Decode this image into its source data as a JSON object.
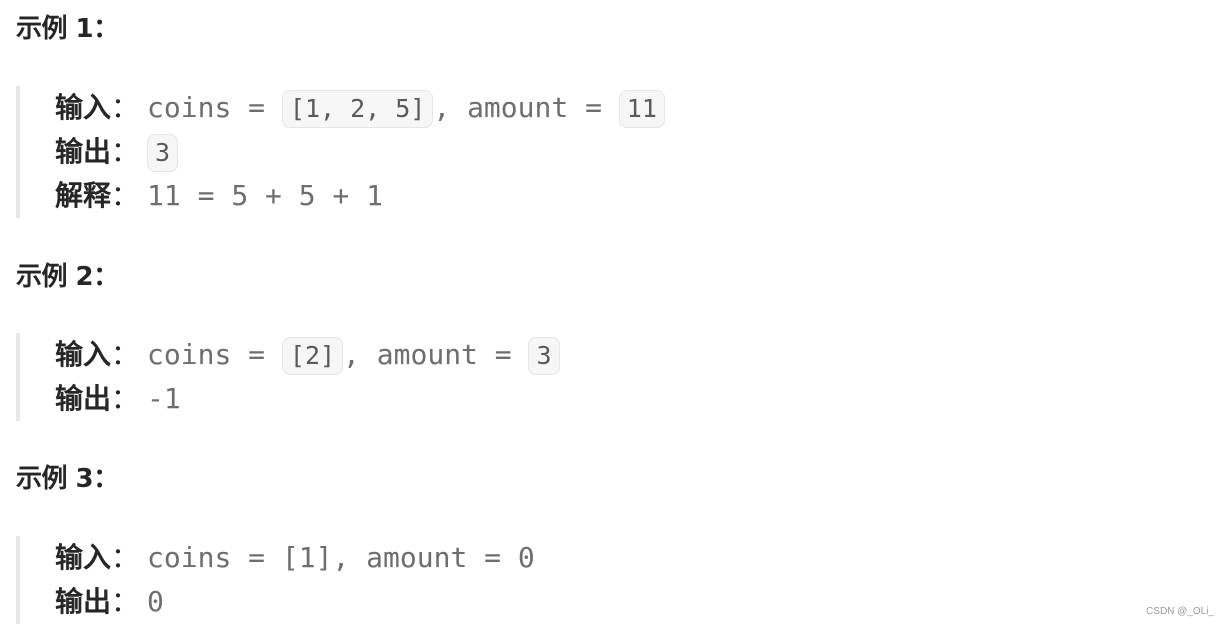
{
  "examples": [
    {
      "title": "示例 1：",
      "input_label": "输入",
      "colon": "：",
      "input_prefix": "coins = ",
      "coins": "[1, 2, 5]",
      "input_mid": ", amount = ",
      "amount": "11",
      "output_label": "输出",
      "output": "3",
      "explain_label": "解释",
      "explain": "11 = 5 + 5 + 1"
    },
    {
      "title": "示例 2：",
      "input_label": "输入",
      "colon": "：",
      "input_prefix": "coins = ",
      "coins": "[2]",
      "input_mid": ", amount = ",
      "amount": "3",
      "output_label": "输出",
      "output": "-1"
    },
    {
      "title": "示例 3：",
      "input_label": "输入",
      "colon": "：",
      "input_text": "coins = [1], amount = 0",
      "output_label": "输出",
      "output": "0"
    }
  ],
  "watermark": "CSDN @_OLi_"
}
